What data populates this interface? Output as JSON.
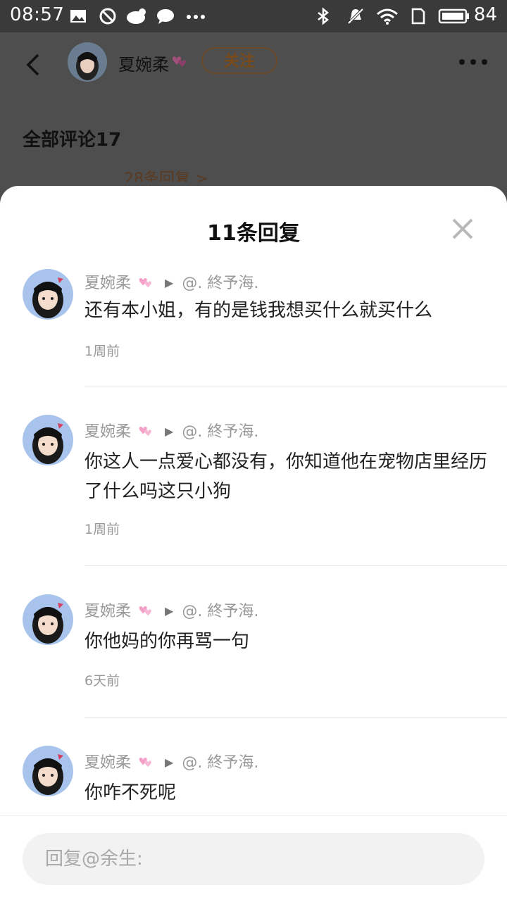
{
  "status_bar": {
    "time": "08:57",
    "battery": "84"
  },
  "header": {
    "author_name": "夏婉柔",
    "follow_label": "关注"
  },
  "comments_heading": "全部评论17",
  "behind_peek_text": "28条回复 >",
  "sheet": {
    "title": "11条回复",
    "replies": [
      {
        "from": "夏婉柔",
        "to": "@. 終予海.",
        "text": "还有本小姐，有的是钱我想买什么就买什么",
        "time": "1周前"
      },
      {
        "from": "夏婉柔",
        "to": "@. 終予海.",
        "text": "你这人一点爱心都没有，你知道他在宠物店里经历了什么吗这只小狗",
        "time": "1周前"
      },
      {
        "from": "夏婉柔",
        "to": "@. 終予海.",
        "text": "你他妈的你再骂一句",
        "time": "6天前"
      },
      {
        "from": "夏婉柔",
        "to": "@. 終予海.",
        "text": "你咋不死呢",
        "time": ""
      }
    ]
  },
  "input": {
    "placeholder": "回复@余生:"
  },
  "colors": {
    "follow_border": "#6a4a2a",
    "heart": "#f5a0c8",
    "sheet_bg": "#ffffff"
  }
}
